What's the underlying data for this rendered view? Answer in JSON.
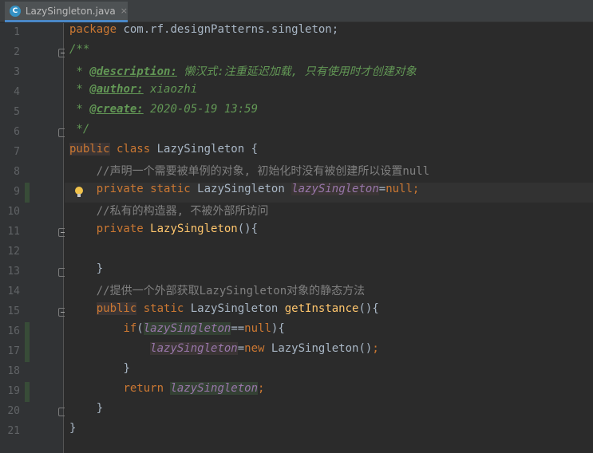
{
  "tab": {
    "icon": "C",
    "filename": "LazySingleton.java",
    "close": "×"
  },
  "line_numbers": [
    "1",
    "2",
    "3",
    "4",
    "5",
    "6",
    "7",
    "8",
    "9",
    "10",
    "11",
    "12",
    "13",
    "14",
    "15",
    "16",
    "17",
    "18",
    "19",
    "20",
    "21"
  ],
  "colors": {
    "editor_bg": "#2b2b2b",
    "gutter_bg": "#313335",
    "keyword": "#cc7832",
    "doc_comment": "#629755",
    "comment": "#808080",
    "field": "#9876aa",
    "method": "#ffc66d",
    "text": "#a9b7c6"
  },
  "code": {
    "l1": {
      "kw": "package",
      "rest": " com.rf.designPatterns.singleton;"
    },
    "l2": {
      "text": "/**"
    },
    "l3": {
      "star": " * ",
      "tag": "@description:",
      "text": " 懒汉式:注重延迟加载, 只有使用时才创建对象"
    },
    "l4": {
      "star": " * ",
      "tag": "@author:",
      "text": " xiaozhi"
    },
    "l5": {
      "star": " * ",
      "tag": "@create:",
      "text": " 2020-05-19 13:59"
    },
    "l6": {
      "text": " */"
    },
    "l7": {
      "kw1": "public",
      "kw2": " class",
      "rest": " LazySingleton {"
    },
    "l8": {
      "indent": "    ",
      "text": "//声明一个需要被单例的对象, 初始化时没有被创建所以设置null"
    },
    "l9": {
      "indent": "    ",
      "kw1": "private",
      "kw2": " static",
      "type": " LazySingleton ",
      "field": "lazySingleton",
      "assign": "=",
      "val": "null",
      "semi": ";"
    },
    "l10": {
      "indent": "    ",
      "text": "//私有的构造器, 不被外部所访问"
    },
    "l11": {
      "indent": "    ",
      "kw": "private",
      "method": " LazySingleton",
      "rest": "(){"
    },
    "l12": {
      "text": ""
    },
    "l13": {
      "indent": "    ",
      "text": "}"
    },
    "l14": {
      "indent": "    ",
      "text": "//提供一个外部获取LazySingleton对象的静态方法"
    },
    "l15": {
      "indent": "    ",
      "kw1": "public",
      "kw2": " static",
      "type": " LazySingleton ",
      "method": "getInstance",
      "rest": "(){"
    },
    "l16": {
      "indent": "        ",
      "kw": "if",
      "open": "(",
      "field": "lazySingleton",
      "eq": "==",
      "val": "null",
      "rest": "){"
    },
    "l17": {
      "indent": "            ",
      "field": "lazySingleton",
      "assign": "=",
      "kw": "new",
      "rest": " LazySingleton()",
      "semi": ";"
    },
    "l18": {
      "indent": "        ",
      "text": "}"
    },
    "l19": {
      "indent": "        ",
      "kw": "return",
      "sp": " ",
      "field": "lazySingleton",
      "semi": ";"
    },
    "l20": {
      "indent": "    ",
      "text": "}"
    },
    "l21": {
      "text": "}"
    }
  }
}
